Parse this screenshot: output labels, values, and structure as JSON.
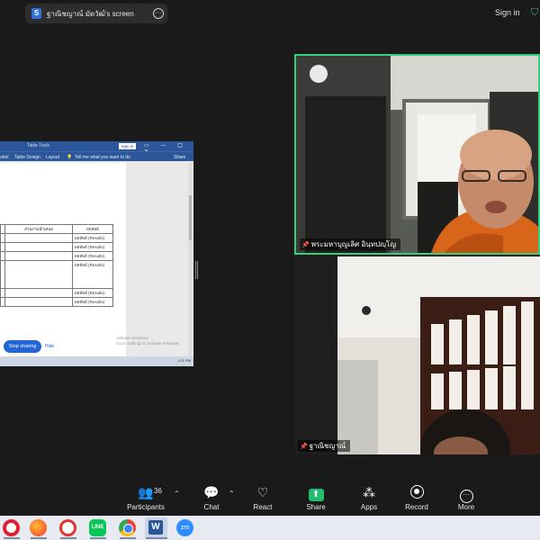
{
  "topbar": {
    "screen_badge": "S",
    "screen_label": "ฐาณิชญาณ์ มัดวัฒ์'s screen",
    "more": "···",
    "sign_in": "Sign in"
  },
  "shared_word": {
    "tab_tools": "Table Tools",
    "sign_in_btn": "Sign in",
    "ribbon": [
      "obel",
      "Table Design",
      "Layout",
      "Tell me what you want to do",
      "Share"
    ],
    "table": {
      "headers": [
        "ส่วนงานนำเสนอ",
        "ผลลัพธ์"
      ],
      "cells": [
        "ผลลัพธ์ (Results)",
        "ผลลัพธ์ (Results)",
        "ผลลัพธ์ (Results)",
        "ผลลัพธ์ (Results)",
        "ผลลัพธ์ (Results)",
        "ผลลัพธ์ (Results)"
      ]
    },
    "stop_sharing": "Stop sharing",
    "hide": "Hide",
    "activate_line1": "Activate Windows",
    "activate_line2": "Go to Settings to activate Windows.",
    "zoom_pct": "100%",
    "clock": "1:01 PM"
  },
  "videos": [
    {
      "name": "พระมหาบุญเลิศ อินฺทปญฺโญ",
      "active_speaker": true
    },
    {
      "name": "ฐาณิชญาณ์",
      "active_speaker": false
    }
  ],
  "toolbar": {
    "participants_count": "36",
    "participants": "Participants",
    "chat": "Chat",
    "react": "React",
    "share": "Share",
    "apps": "Apps",
    "record": "Record",
    "more": "More"
  },
  "taskbar": {
    "apps": [
      "opera",
      "firefox",
      "app",
      "line",
      "chrome",
      "word",
      "zoom"
    ],
    "line_label": "LINE",
    "word_label": "W",
    "zoom_label": "zm"
  },
  "colors": {
    "active_speaker_border": "#2fd27a",
    "share_green": "#1fbf6f",
    "word_blue": "#2b579a",
    "stop_sharing_blue": "#2166d4"
  }
}
